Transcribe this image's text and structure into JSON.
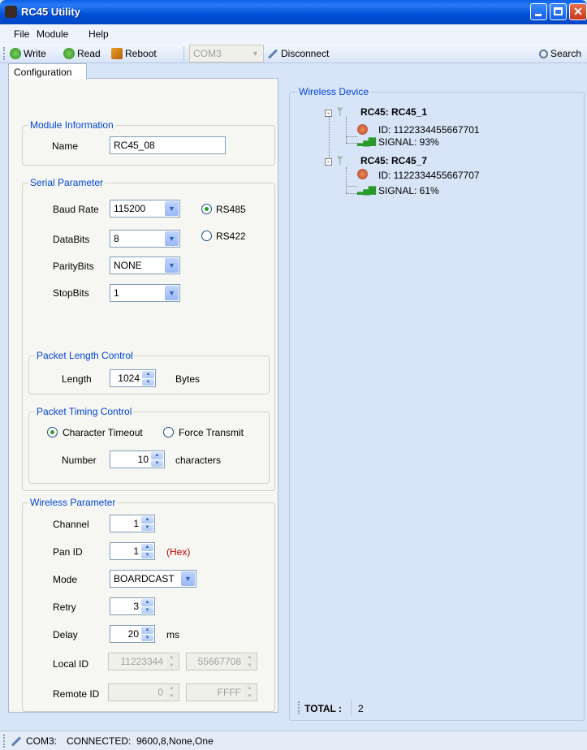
{
  "window": {
    "title": "RC45 Utility"
  },
  "menu": {
    "file": "File",
    "module": "Module",
    "help": "Help"
  },
  "toolbar": {
    "write": "Write",
    "read": "Read",
    "reboot": "Reboot",
    "port": "COM3",
    "disconnect": "Disconnect",
    "search": "Search"
  },
  "tab": {
    "configuration": "Configuration"
  },
  "module_info": {
    "title": "Module Information",
    "name_label": "Name",
    "name_value": "RC45_08"
  },
  "serial": {
    "title": "Serial Parameter",
    "baud_label": "Baud Rate",
    "baud_value": "115200",
    "databits_label": "DataBits",
    "databits_value": "8",
    "parity_label": "ParityBits",
    "parity_value": "NONE",
    "stopbits_label": "StopBits",
    "stopbits_value": "1",
    "rs485": "RS485",
    "rs422": "RS422"
  },
  "packet_length": {
    "title": "Packet Length Control",
    "length_label": "Length",
    "length_value": "1024",
    "unit": "Bytes"
  },
  "packet_timing": {
    "title": "Packet Timing Control",
    "char_timeout": "Character Timeout",
    "force_transmit": "Force Transmit",
    "number_label": "Number",
    "number_value": "10",
    "unit": "characters"
  },
  "wireless": {
    "title": "Wireless Parameter",
    "channel_label": "Channel",
    "channel_value": "1",
    "panid_label": "Pan ID",
    "panid_value": "1",
    "hex": "(Hex)",
    "mode_label": "Mode",
    "mode_value": "BOARDCAST",
    "retry_label": "Retry",
    "retry_value": "3",
    "delay_label": "Delay",
    "delay_value": "20",
    "delay_unit": "ms",
    "localid_label": "Local ID",
    "localid_a": "11223344",
    "localid_b": "55667708",
    "remoteid_label": "Remote ID",
    "remoteid_a": "0",
    "remoteid_b": "FFFF"
  },
  "devices": {
    "title": "Wireless Device",
    "items": [
      {
        "name": "RC45: RC45_1",
        "id": "ID: 1122334455667701",
        "signal": "SIGNAL: 93%"
      },
      {
        "name": "RC45: RC45_7",
        "id": "ID: 1122334455667707",
        "signal": "SIGNAL: 61%"
      }
    ],
    "total_label": "TOTAL :",
    "total_value": "2"
  },
  "status": {
    "port": "COM3:",
    "state": "CONNECTED:",
    "params": "9600,8,None,One"
  },
  "colors": {
    "title_bar": "#0a5fe8",
    "group_title": "#0046d5",
    "hex_label": "#c00000"
  }
}
